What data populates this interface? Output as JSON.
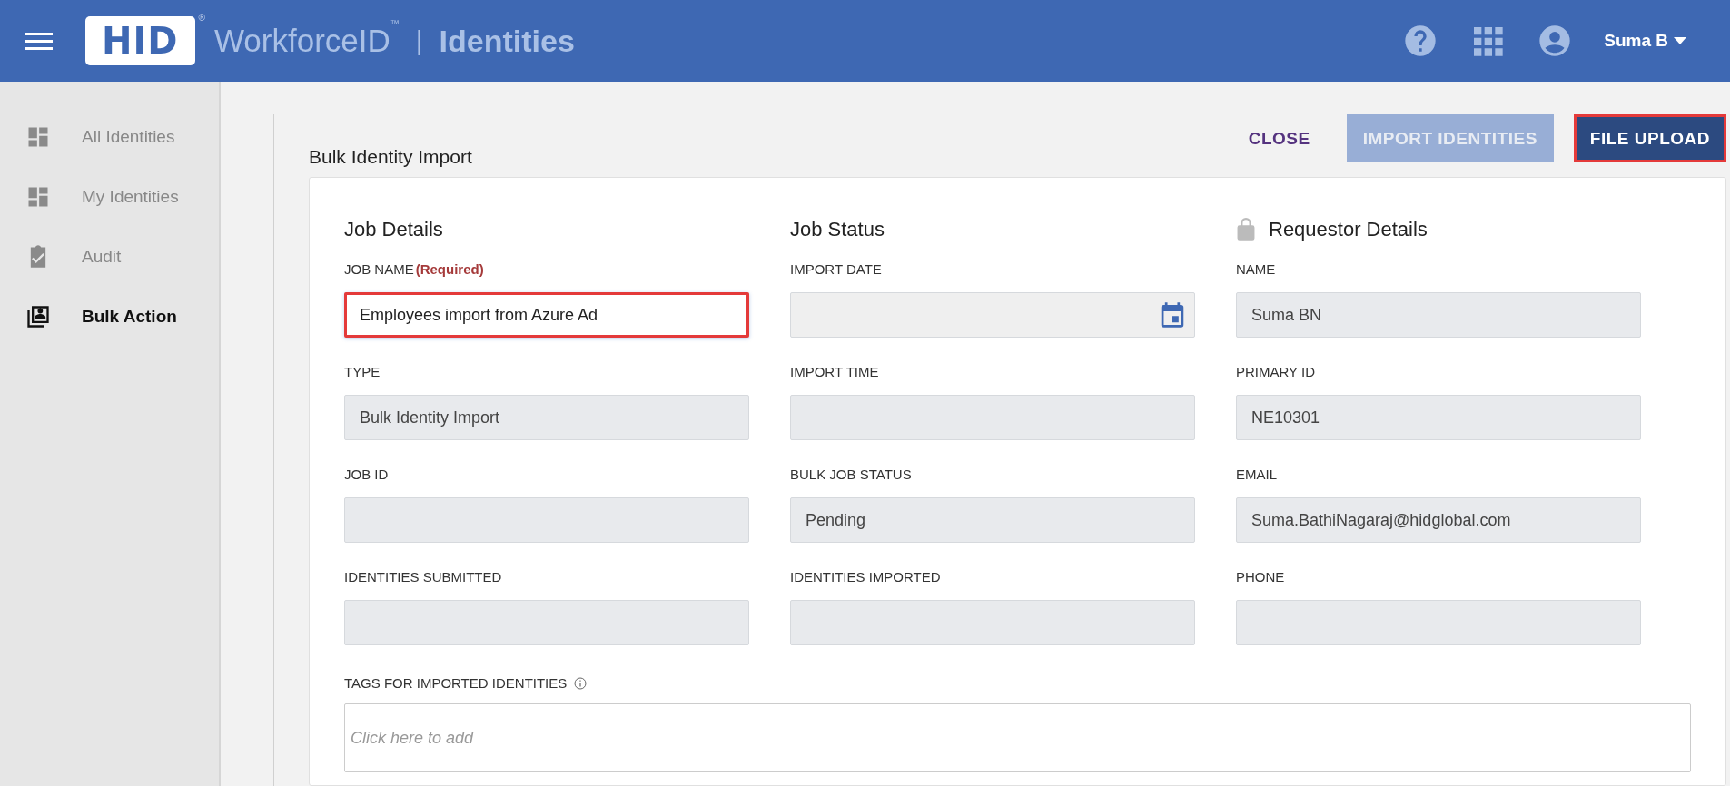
{
  "header": {
    "logo": "HID",
    "registered_mark": "®",
    "product": "WorkforceID",
    "trademark": "™",
    "separator": "|",
    "section": "Identities",
    "user": "Suma B"
  },
  "sidebar": {
    "items": [
      {
        "label": "All Identities",
        "selected": false
      },
      {
        "label": "My Identities",
        "selected": false
      },
      {
        "label": "Audit",
        "selected": false
      },
      {
        "label": "Bulk Action",
        "selected": true
      }
    ]
  },
  "page": {
    "title": "Bulk Identity Import",
    "actions": [
      {
        "label": "CLOSE",
        "kind": "text",
        "disabled": false,
        "highlighted": false
      },
      {
        "label": "IMPORT IDENTITIES",
        "kind": "filled",
        "disabled": true,
        "highlighted": false
      },
      {
        "label": "FILE UPLOAD",
        "kind": "filled",
        "disabled": false,
        "highlighted": true
      }
    ]
  },
  "columns": [
    {
      "title": "Job Details",
      "locked": false,
      "fields": [
        {
          "label": "JOB NAME",
          "required": "(Required)",
          "kind": "input",
          "value": "Employees import from Azure Ad",
          "highlighted": true
        },
        {
          "label": "TYPE",
          "kind": "readonly",
          "value": "Bulk Identity Import",
          "highlighted": false
        },
        {
          "label": "JOB ID",
          "kind": "readonly",
          "highlighted": false
        },
        {
          "label": "IDENTITIES SUBMITTED",
          "kind": "readonly",
          "highlighted": false
        }
      ]
    },
    {
      "title": "Job Status",
      "locked": false,
      "fields": [
        {
          "label": "IMPORT DATE",
          "kind": "date",
          "highlighted": false
        },
        {
          "label": "IMPORT TIME",
          "kind": "readonly",
          "highlighted": false
        },
        {
          "label": "BULK JOB STATUS",
          "kind": "readonly",
          "value": "Pending",
          "highlighted": false
        },
        {
          "label": "IDENTITIES IMPORTED",
          "kind": "readonly",
          "highlighted": false
        }
      ]
    },
    {
      "title": "Requestor Details",
      "locked": true,
      "fields": [
        {
          "label": "NAME",
          "kind": "readonly",
          "value": "Suma BN",
          "highlighted": false
        },
        {
          "label": "PRIMARY ID",
          "kind": "readonly",
          "value": "NE10301",
          "highlighted": false
        },
        {
          "label": "EMAIL",
          "kind": "readonly",
          "value": "Suma.BathiNagaraj@hidglobal.com",
          "highlighted": false
        },
        {
          "label": "PHONE",
          "kind": "readonly",
          "highlighted": false
        }
      ]
    }
  ],
  "tags": {
    "label": "TAGS FOR IMPORTED IDENTITIES",
    "placeholder": "Click here to add"
  }
}
